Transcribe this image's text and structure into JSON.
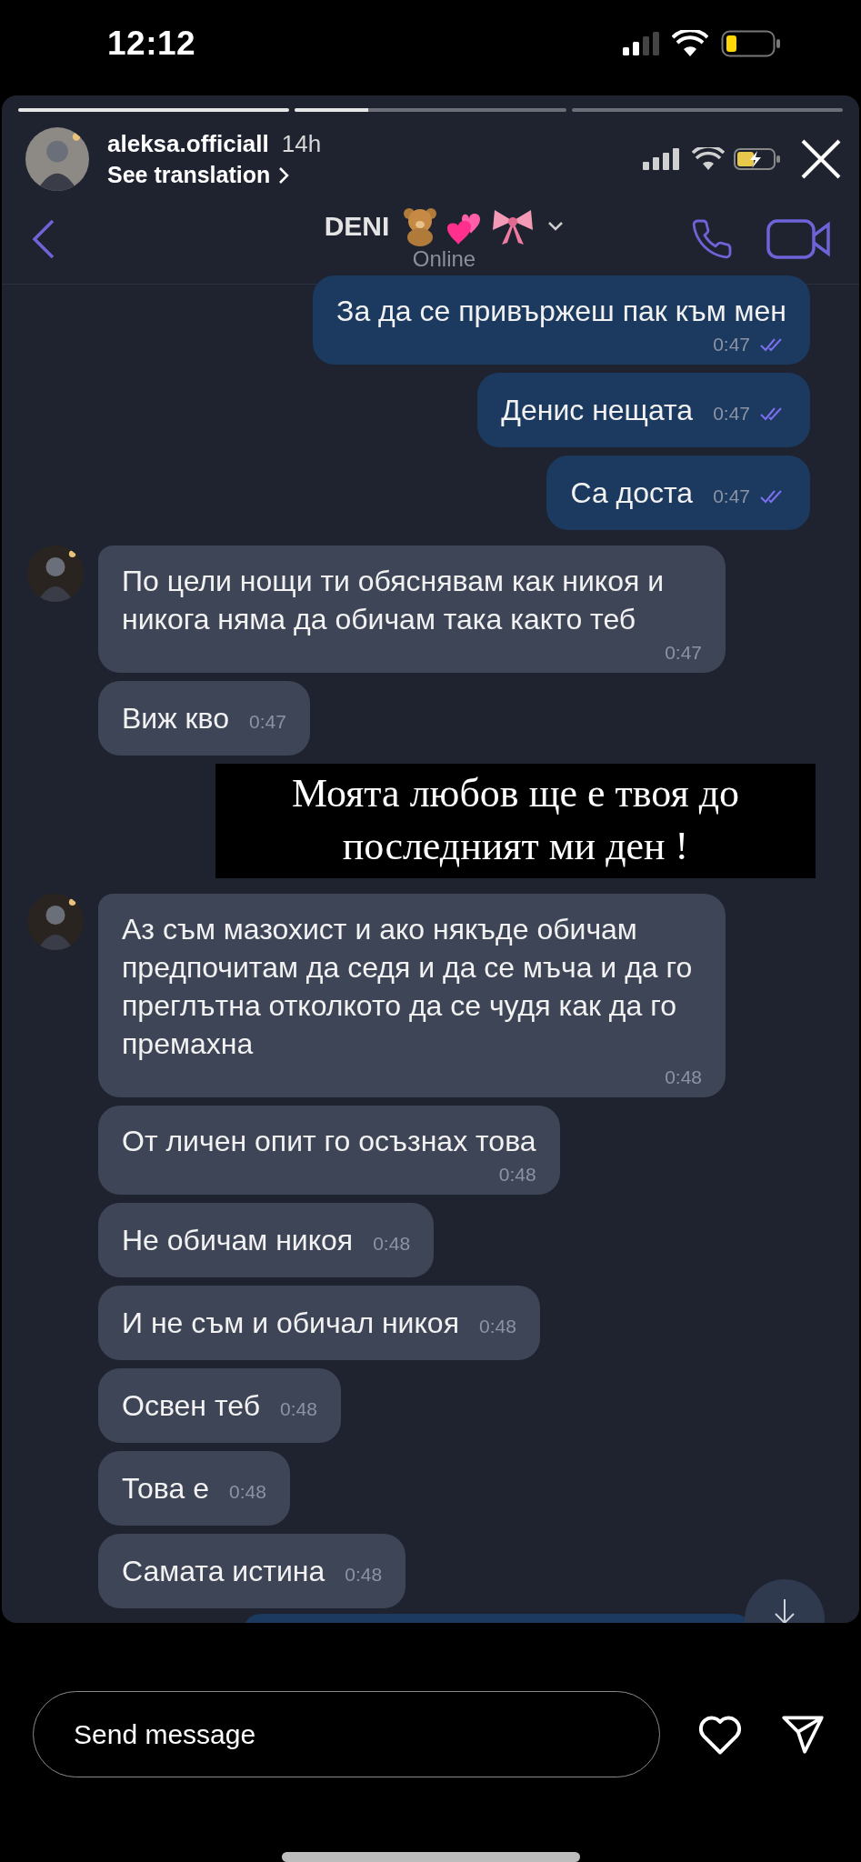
{
  "status_bar": {
    "time": "12:12"
  },
  "story": {
    "progress": [
      {
        "level": 1
      },
      {
        "level": 0.27
      },
      {
        "level": 0
      }
    ],
    "username": "aleksa.officiall",
    "age": "14h",
    "translation_link": "See translation"
  },
  "chat": {
    "contact_name": "DENI",
    "presence": "Online"
  },
  "thread": [
    {
      "kind": "outgoing",
      "text": "За да се привържеш пак към мен",
      "time": "0:47",
      "read": true,
      "time_below": true,
      "avatar": false
    },
    {
      "kind": "outgoing",
      "text": "Денис нещата",
      "time": "0:47",
      "read": true,
      "time_below": false,
      "avatar": false
    },
    {
      "kind": "outgoing",
      "text": "Са доста",
      "time": "0:47",
      "read": true,
      "time_below": false,
      "avatar": false
    },
    {
      "kind": "incoming",
      "text": "По цели нощи ти обяснявам как никоя и никога няма да обичам така както теб",
      "time": "0:47",
      "time_below": true,
      "avatar": true
    },
    {
      "kind": "incoming",
      "text": "Виж кво",
      "time": "0:47",
      "time_below": false,
      "avatar": false
    },
    {
      "kind": "caption",
      "text": "Моята любов ще е твоя до\nпоследният ми ден !"
    },
    {
      "kind": "incoming",
      "text": "Аз съм мазохист и ако някъде обичам предпочитам да седя и да се мъча и да го преглътна отколкото да се чудя как да го премахна",
      "time": "0:48",
      "time_below": true,
      "avatar": true
    },
    {
      "kind": "incoming",
      "text": "От личен опит го осъзнах това",
      "time": "0:48",
      "time_below": true,
      "avatar": false
    },
    {
      "kind": "incoming",
      "text": "Не обичам никоя",
      "time": "0:48",
      "time_below": false,
      "avatar": false
    },
    {
      "kind": "incoming",
      "text": "И не съм и обичал никоя",
      "time": "0:48",
      "time_below": false,
      "avatar": false
    },
    {
      "kind": "incoming",
      "text": "Освен теб",
      "time": "0:48",
      "time_below": false,
      "avatar": false
    },
    {
      "kind": "incoming",
      "text": "Това е",
      "time": "0:48",
      "time_below": false,
      "avatar": false
    },
    {
      "kind": "incoming",
      "text": "Самата истина",
      "time": "0:48",
      "time_below": false,
      "avatar": false
    }
  ],
  "reply": {
    "placeholder": "Send message"
  }
}
